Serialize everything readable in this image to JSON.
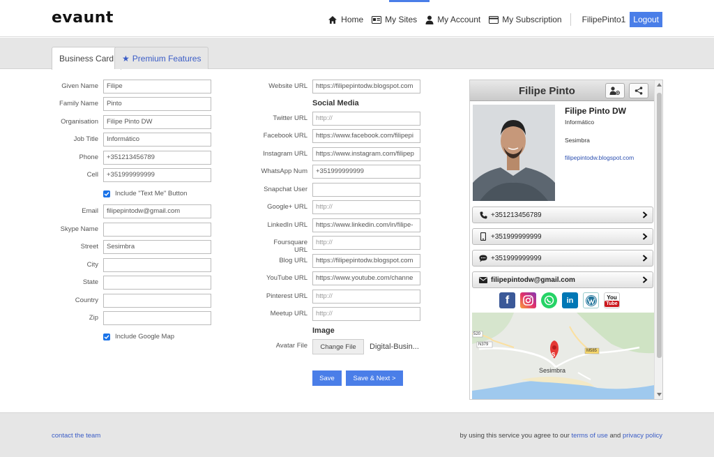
{
  "header": {
    "logo": "evaunt",
    "nav": {
      "home": "Home",
      "my_sites": "My Sites",
      "my_account": "My Account",
      "my_subscription": "My Subscription"
    },
    "username": "FilipePinto1",
    "logout": "Logout",
    "accent_color": "#4a7ee8"
  },
  "tabs": {
    "business_card": "Business Card",
    "premium_features": "Premium Features"
  },
  "form_left": {
    "given_name": {
      "label": "Given Name",
      "value": "Filipe"
    },
    "family_name": {
      "label": "Family Name",
      "value": "Pinto"
    },
    "organisation": {
      "label": "Organisation",
      "value": "Filipe Pinto DW"
    },
    "job_title": {
      "label": "Job Title",
      "value": "Informático"
    },
    "phone": {
      "label": "Phone",
      "value": "+351213456789"
    },
    "cell": {
      "label": "Cell",
      "value": "+351999999999"
    },
    "text_me": {
      "label": "Include \"Text Me\" Button",
      "checked": true
    },
    "email": {
      "label": "Email",
      "value": "filipepintodw@gmail.com"
    },
    "skype": {
      "label": "Skype Name",
      "value": ""
    },
    "street": {
      "label": "Street",
      "value": "Sesimbra"
    },
    "city": {
      "label": "City",
      "value": ""
    },
    "state": {
      "label": "State",
      "value": ""
    },
    "country": {
      "label": "Country",
      "value": ""
    },
    "zip": {
      "label": "Zip",
      "value": ""
    },
    "google_map": {
      "label": "Include Google Map",
      "checked": true
    }
  },
  "form_right": {
    "website": {
      "label": "Website URL",
      "value": "https://filipepintodw.blogspot.com"
    },
    "social_title": "Social Media",
    "twitter": {
      "label": "Twitter URL",
      "placeholder": "http://"
    },
    "facebook": {
      "label": "Facebook URL",
      "value": "https://www.facebook.com/filipepi"
    },
    "instagram": {
      "label": "Instagram URL",
      "value": "https://www.instagram.com/filipep"
    },
    "whatsapp": {
      "label": "WhatsApp Num",
      "value": "+351999999999"
    },
    "snapchat": {
      "label": "Snapchat User",
      "value": ""
    },
    "googleplus": {
      "label": "Google+ URL",
      "placeholder": "http://"
    },
    "linkedin": {
      "label": "LinkedIn URL",
      "value": "https://www.linkedin.com/in/filipe-"
    },
    "foursquare": {
      "label": "Foursquare URL",
      "placeholder": "http://"
    },
    "blog": {
      "label": "Blog URL",
      "value": "https://filipepintodw.blogspot.com"
    },
    "youtube": {
      "label": "YouTube URL",
      "value": "https://www.youtube.com/channe"
    },
    "pinterest": {
      "label": "Pinterest URL",
      "placeholder": "http://"
    },
    "meetup": {
      "label": "Meetup URL",
      "placeholder": "http://"
    },
    "image_title": "Image",
    "avatar": {
      "label": "Avatar File",
      "button": "Change File",
      "filename": "Digital-Busin..."
    },
    "save": "Save",
    "save_next": "Save & Next >"
  },
  "preview": {
    "title": "Filipe Pinto",
    "full_name": "Filipe Pinto DW",
    "job": "Informático",
    "street": "Sesimbra",
    "website": "filipepintodw.blogspot.com",
    "phone": "+351213456789",
    "cell": "+351999999999",
    "text": "+351999999999",
    "email": "filipepintodw@gmail.com",
    "social": {
      "facebook": "f",
      "linkedin": "in",
      "youtube_top": "You",
      "youtube_bottom": "Tube"
    },
    "map": {
      "marker": "S",
      "place": "Sesimbra",
      "road_n379": "N379",
      "road_520": "520",
      "road_m585": "M585"
    }
  },
  "footer": {
    "contact": "contact the team",
    "agree_prefix": "by using this service you agree to our",
    "terms": "terms of use",
    "and": "and",
    "privacy": "privacy policy"
  }
}
